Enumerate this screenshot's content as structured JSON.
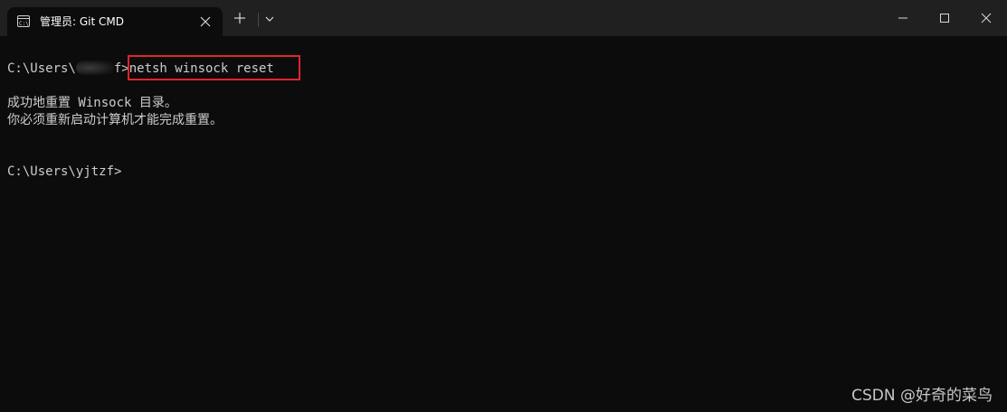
{
  "window": {
    "tab_title": "管理员: Git CMD",
    "icons": {
      "tab_icon": "terminal-icon",
      "tab_close": "close-icon",
      "new_tab": "plus-icon",
      "dropdown": "chevron-down-icon",
      "minimize": "minimize-icon",
      "maximize": "maximize-icon",
      "close": "close-icon"
    }
  },
  "terminal": {
    "line1_prompt_prefix": "C:\\Users\\",
    "line1_prompt_suffix": "f>",
    "line1_command": "netsh winsock reset",
    "line2": "成功地重置 Winsock 目录。",
    "line3": "你必须重新启动计算机才能完成重置。",
    "line4_prompt": "C:\\Users\\yjtzf>"
  },
  "overlay": {
    "watermark": "CSDN @好奇的菜鸟",
    "highlight_color": "#e0242b"
  },
  "colors": {
    "background": "#0c0c0c",
    "titlebar": "#202020",
    "text": "#cccccc"
  }
}
